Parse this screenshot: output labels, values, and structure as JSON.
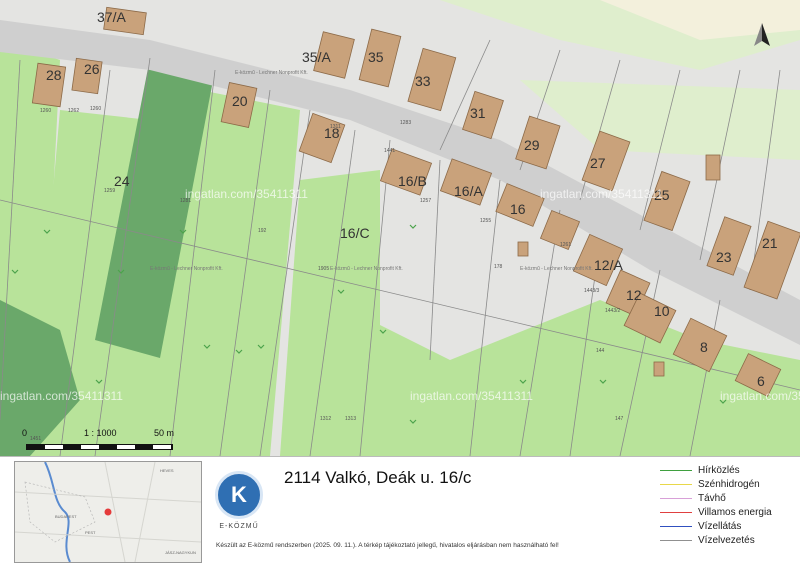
{
  "map": {
    "parcel_numbers": [
      "37/A",
      "28",
      "26",
      "35/A",
      "35",
      "33",
      "31",
      "29",
      "27",
      "25",
      "23",
      "21",
      "24",
      "20",
      "18",
      "16/B",
      "16/A",
      "16",
      "16/C",
      "12/A",
      "12",
      "10",
      "8",
      "6"
    ],
    "lot_codes": [
      "1260",
      "1260",
      "1262",
      "1259",
      "1281",
      "1283",
      "1257",
      "1255",
      "1261",
      "192",
      "1905",
      "178",
      "1443/3",
      "1443/2",
      "144",
      "1441",
      "1451",
      "1311",
      "1312",
      "1313",
      "147"
    ],
    "watermarks": [
      "ingatlan.com/35411311",
      "ingatlan.com/35411311",
      "ingatlan.com/35411311",
      "ingatlan.com/35411311",
      "ingatlan.com/35411311"
    ],
    "credits": [
      "E-közmű - Lechner Nonprofit Kft.",
      "E-közmű - Lechner Nonprofit Kft.",
      "E-közmű - Lechner Nonprofit Kft.",
      "E-közmű - Lechner Nonprofit Kft."
    ],
    "colors": {
      "base": "#e4e4e2",
      "green": "#b8e39a",
      "dark_green": "#6aa86a",
      "road": "#cfcfcf",
      "building": "#c9a27b",
      "line": "#8a8a8a"
    }
  },
  "scale": {
    "start": "0",
    "ratio": "1 : 1000",
    "end": "50 m"
  },
  "north_icon": "north-arrow-icon",
  "logo": {
    "letter": "K",
    "text": "E-KÖZMŰ"
  },
  "title": "2114 Valkó, Deák u. 16/c",
  "disclaimer": "Készült az E-közmű rendszerben (2025. 09. 11.). A térkép tájékoztató jellegű, hivatalos eljárásban nem használható fel!",
  "legend": [
    {
      "label": "Hírközlés",
      "color": "#3fa03f"
    },
    {
      "label": "Szénhidrogén",
      "color": "#e8d84a"
    },
    {
      "label": "Távhő",
      "color": "#d8a0d8"
    },
    {
      "label": "Villamos energia",
      "color": "#e04040"
    },
    {
      "label": "Vízellátás",
      "color": "#3050c0"
    },
    {
      "label": "Vízelvezetés",
      "color": "#909090"
    }
  ],
  "inset_labels": [
    "HEVES",
    "BUDAPEST",
    "PEST",
    "JÁSZ-NAGYKUN"
  ]
}
